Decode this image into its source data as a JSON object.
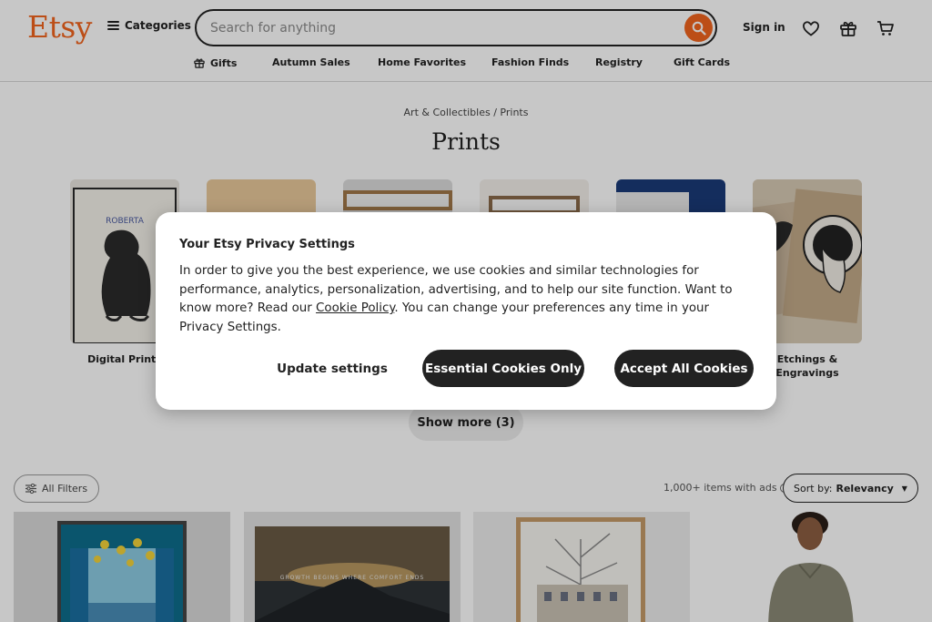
{
  "header": {
    "logo": "Etsy",
    "categories_label": "Categories",
    "search_placeholder": "Search for anything",
    "sign_in": "Sign in",
    "icons": [
      "search-icon",
      "heart-icon",
      "gift-icon",
      "cart-icon"
    ],
    "accent_color": "#f1641e"
  },
  "nav": {
    "items": [
      "Gifts",
      "Autumn Sales",
      "Home Favorites",
      "Fashion Finds",
      "Registry",
      "Gift Cards"
    ]
  },
  "breadcrumb": {
    "parent": "Art & Collectibles",
    "separator": "/",
    "current": "Prints"
  },
  "page_title": "Prints",
  "subcategories": [
    {
      "label": "Digital Prints"
    },
    {
      "label": "Etchings & Engravings"
    }
  ],
  "dog_art_text": "ROBERTA",
  "poster_text": "GROWTH BEGINS WHERE COMFORT ENDS",
  "show_more": "Show more (3)",
  "filters": {
    "all_filters": "All Filters",
    "items_count": "1,000+ items with ads",
    "sort_prefix": "Sort by:",
    "sort_value": "Relevancy"
  },
  "privacy_dialog": {
    "title": "Your Etsy Privacy Settings",
    "body_before_link": "In order to give you the best experience, we use cookies and similar technologies for performance, analytics, personalization, advertising, and to help our site function. Want to know more? Read our ",
    "link_text": "Cookie Policy",
    "body_after_link": ". You can change your preferences any time in your Privacy Settings.",
    "update_settings": "Update settings",
    "essential_only": "Essential Cookies Only",
    "accept_all": "Accept All Cookies"
  }
}
